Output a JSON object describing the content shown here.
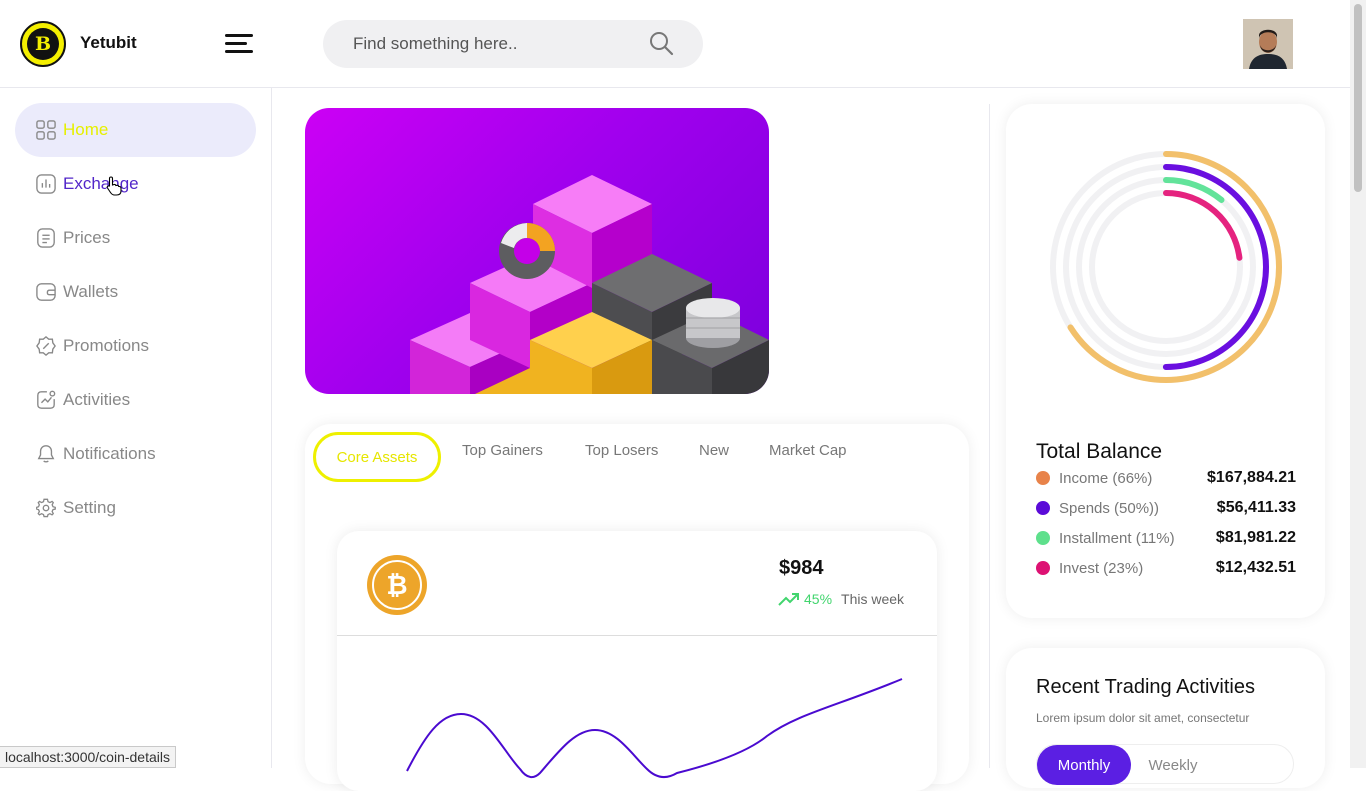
{
  "header": {
    "brand": "Yetubit",
    "logo_letter": "B",
    "search_placeholder": "Find something here.."
  },
  "sidebar": {
    "items": [
      {
        "label": "Home",
        "icon": "grid-icon",
        "state": "active"
      },
      {
        "label": "Exchange",
        "icon": "bar-chart-icon",
        "state": "hover"
      },
      {
        "label": "Prices",
        "icon": "document-icon",
        "state": "normal"
      },
      {
        "label": "Wallets",
        "icon": "wallet-icon",
        "state": "normal"
      },
      {
        "label": "Promotions",
        "icon": "discount-badge-icon",
        "state": "normal"
      },
      {
        "label": "Activities",
        "icon": "activity-icon",
        "state": "normal"
      },
      {
        "label": "Notifications",
        "icon": "bell-icon",
        "state": "normal"
      },
      {
        "label": "Setting",
        "icon": "gear-icon",
        "state": "normal"
      }
    ]
  },
  "assets": {
    "tabs": [
      "Core Assets",
      "Top Gainers",
      "Top Losers",
      "New",
      "Market Cap"
    ],
    "active_tab": "Core Assets",
    "coin": {
      "icon": "bitcoin-icon",
      "price": "$984",
      "change": "45%",
      "period": "This week"
    }
  },
  "balance": {
    "title": "Total Balance",
    "rings": [
      {
        "name": "Income",
        "percent": 66,
        "color": "#f2c06b"
      },
      {
        "name": "Spends",
        "percent": 50,
        "color": "#6a0fe0"
      },
      {
        "name": "Installment",
        "percent": 11,
        "color": "#62e39a"
      },
      {
        "name": "Invest",
        "percent": 23,
        "color": "#e5237f"
      }
    ],
    "legend": [
      {
        "name": "Income (66%)",
        "amount": "$167,884.21",
        "color": "#e8834a"
      },
      {
        "name": "Spends (50%))",
        "amount": "$56,411.33",
        "color": "#5b0bd8"
      },
      {
        "name": "Installment (11%)",
        "amount": "$81,981.22",
        "color": "#5ee08c"
      },
      {
        "name": "Invest (23%)",
        "amount": "$12,432.51",
        "color": "#dd1273"
      }
    ]
  },
  "activity": {
    "title": "Recent Trading Activities",
    "subtitle": "Lorem ipsum dolor sit amet, consectetur",
    "options": [
      "Monthly",
      "Weekly"
    ]
  },
  "status_url": "localhost:3000/coin-details",
  "colors": {
    "accent_purple": "#5b1fe3",
    "accent_yellow": "#eef000",
    "positive_green": "#42d56e"
  }
}
